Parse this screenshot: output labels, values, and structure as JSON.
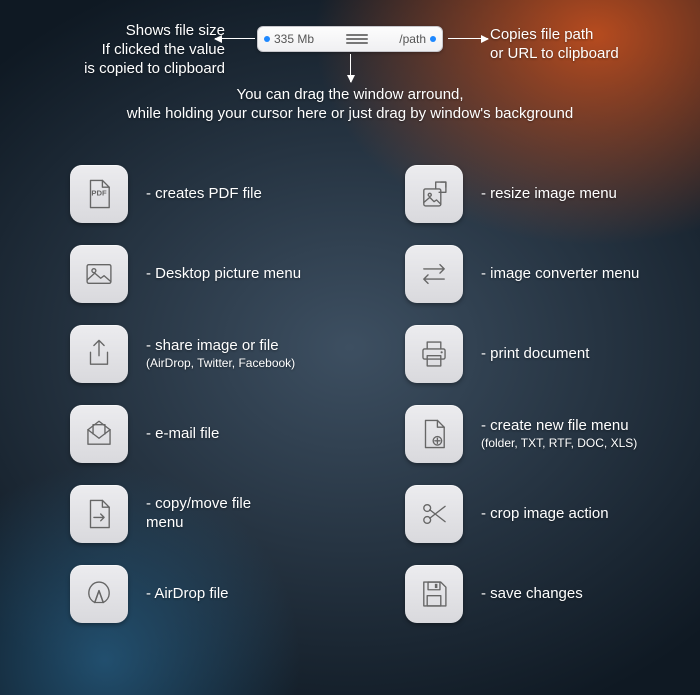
{
  "toolbar": {
    "size": "335 Mb",
    "path": "/path"
  },
  "annotations": {
    "left": "Shows file size\nIf clicked the value\nis copied to clipboard",
    "right": "Copies file path\nor URL to clipboard",
    "drag": "You can drag the window arround,\nwhile holding your cursor here or just drag by window's background"
  },
  "left_col": [
    {
      "name": "pdf",
      "label": "- creates PDF file"
    },
    {
      "name": "desktop",
      "label": "- Desktop picture menu"
    },
    {
      "name": "share",
      "label": "- share image or file",
      "sub": "(AirDrop, Twitter, Facebook)"
    },
    {
      "name": "email",
      "label": "- e-mail file"
    },
    {
      "name": "move",
      "label": "- copy/move file\n      menu"
    },
    {
      "name": "airdrop",
      "label": "- AirDrop file"
    }
  ],
  "right_col": [
    {
      "name": "resize",
      "label": "- resize image menu"
    },
    {
      "name": "convert",
      "label": "- image converter menu"
    },
    {
      "name": "print",
      "label": "- print document"
    },
    {
      "name": "newfile",
      "label": "- create new file menu",
      "sub": "(folder, TXT, RTF, DOC, XLS)"
    },
    {
      "name": "crop",
      "label": "- crop image action"
    },
    {
      "name": "save",
      "label": "- save changes"
    }
  ]
}
